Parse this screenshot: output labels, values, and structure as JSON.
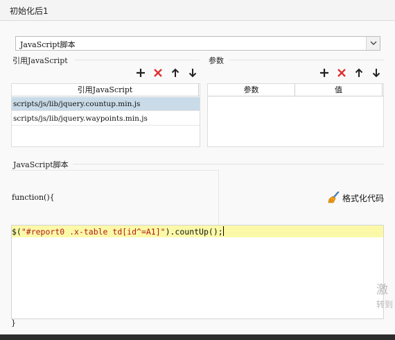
{
  "window": {
    "title": "初始化后1"
  },
  "script_type": {
    "selected": "JavaScript脚本"
  },
  "ref_js": {
    "section_title": "引用JavaScript",
    "column_header": "引用JavaScript",
    "rows": [
      {
        "path": "scripts/js/lib/jquery.countup.min.js",
        "selected": true
      },
      {
        "path": "scripts/js/lib/jquery.waypoints.min.js",
        "selected": false
      }
    ]
  },
  "params": {
    "section_title": "参数",
    "columns": [
      "参数",
      "值"
    ]
  },
  "toolbar_icons": [
    "add-icon",
    "delete-icon",
    "move-up-icon",
    "move-down-icon"
  ],
  "colors": {
    "add": "#222222",
    "delete": "#e03030",
    "selected_row": "#c9dbe8",
    "current_line": "#fbf9a8",
    "string": "#b11a1a"
  },
  "script": {
    "section_title": "JavaScript脚本",
    "function_open": "function(){",
    "function_close": "}",
    "code_line": {
      "dollar": "$(",
      "string": "\"#report0 .x-table td[id^=A1]\"",
      "rest": ").countUp();"
    },
    "format_button": "格式化代码"
  },
  "watermark": {
    "line1": "激",
    "line2": "转到"
  }
}
